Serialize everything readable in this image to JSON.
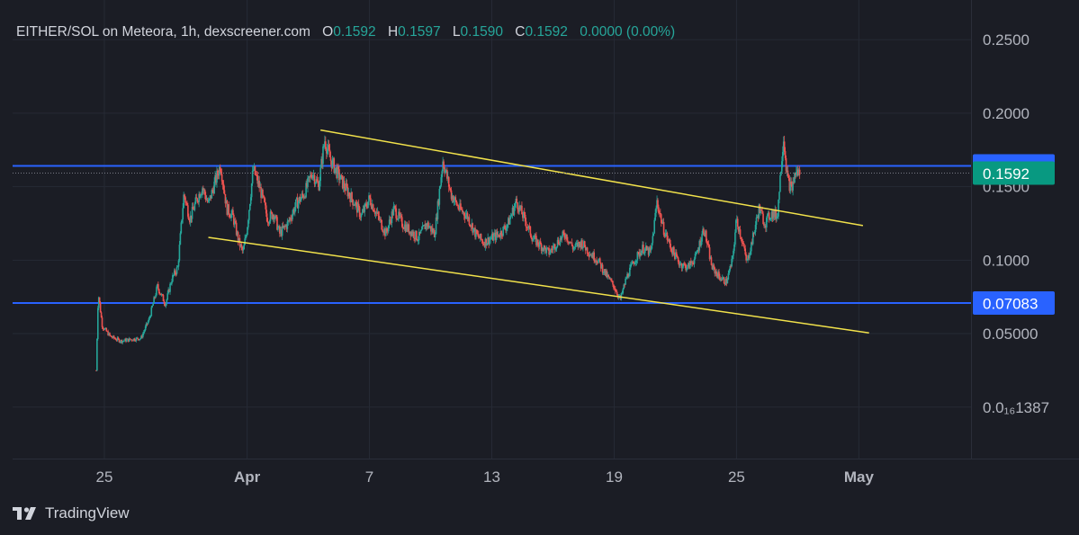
{
  "header": {
    "pair": "EITHER/SOL",
    "exchange": "on Meteora",
    "interval": "1h",
    "source": "dexscreener.com",
    "ohlc": [
      {
        "key": "O",
        "value": "0.1592"
      },
      {
        "key": "H",
        "value": "0.1597"
      },
      {
        "key": "L",
        "value": "0.1590"
      },
      {
        "key": "C",
        "value": "0.1592"
      }
    ],
    "change": "0.0000 (0.00%)"
  },
  "brand": {
    "logo_icon": "tradingview-logo-icon",
    "name": "TradingView"
  },
  "colors": {
    "background": "#1b1d25",
    "up": "#26a69a",
    "down": "#ef5350",
    "horizontal_line": "#2962ff",
    "trendline": "#f2e24b",
    "last_price_label": "#089981",
    "hline_label": "#2962ff"
  },
  "chart_data": {
    "type": "candlestick",
    "y_ticks": [
      "0.2500",
      "0.2000",
      "0.1500",
      "0.1000",
      "0.05000",
      "0.0₁₆1387"
    ],
    "y_tick_values": [
      0.25,
      0.2,
      0.15,
      0.1,
      0.05,
      0.0
    ],
    "x_ticks": [
      "25",
      "Apr",
      "7",
      "13",
      "19",
      "25",
      "May"
    ],
    "x_tick_days": [
      25,
      32,
      38,
      44,
      50,
      56,
      62
    ],
    "x_unit": "day index (March 1 = 1)",
    "xlim": [
      20.5,
      67.5
    ],
    "ylim": [
      -0.035,
      0.277
    ],
    "grid": true,
    "horizontal_lines": [
      {
        "value": 0.1641,
        "label": "0.1641"
      },
      {
        "value": 0.07083,
        "label": "0.07083"
      }
    ],
    "last_price": {
      "value": 0.1592,
      "label": "0.1592"
    },
    "trendlines": [
      {
        "from": {
          "day": 35.6,
          "price": 0.1885
        },
        "to": {
          "day": 62.2,
          "price": 0.1235
        }
      },
      {
        "from": {
          "day": 30.1,
          "price": 0.1155
        },
        "to": {
          "day": 62.5,
          "price": 0.0505
        }
      }
    ],
    "price_path": [
      [
        24.6,
        0.025
      ],
      [
        24.7,
        0.078
      ],
      [
        24.9,
        0.055
      ],
      [
        25.3,
        0.048
      ],
      [
        25.8,
        0.045
      ],
      [
        26.3,
        0.046
      ],
      [
        26.8,
        0.047
      ],
      [
        27.2,
        0.06
      ],
      [
        27.6,
        0.082
      ],
      [
        28.0,
        0.07
      ],
      [
        28.3,
        0.087
      ],
      [
        28.6,
        0.095
      ],
      [
        28.9,
        0.145
      ],
      [
        29.2,
        0.128
      ],
      [
        29.5,
        0.14
      ],
      [
        29.8,
        0.15
      ],
      [
        30.1,
        0.138
      ],
      [
        30.4,
        0.152
      ],
      [
        30.7,
        0.165
      ],
      [
        31.0,
        0.135
      ],
      [
        31.3,
        0.13
      ],
      [
        31.6,
        0.112
      ],
      [
        31.8,
        0.105
      ],
      [
        32.0,
        0.122
      ],
      [
        32.3,
        0.162
      ],
      [
        32.6,
        0.15
      ],
      [
        32.8,
        0.14
      ],
      [
        33.0,
        0.128
      ],
      [
        33.3,
        0.132
      ],
      [
        33.6,
        0.118
      ],
      [
        34.0,
        0.125
      ],
      [
        34.4,
        0.138
      ],
      [
        34.8,
        0.145
      ],
      [
        35.2,
        0.16
      ],
      [
        35.5,
        0.15
      ],
      [
        35.8,
        0.182
      ],
      [
        36.1,
        0.168
      ],
      [
        36.4,
        0.16
      ],
      [
        36.7,
        0.152
      ],
      [
        37.0,
        0.145
      ],
      [
        37.3,
        0.138
      ],
      [
        37.6,
        0.13
      ],
      [
        38.0,
        0.142
      ],
      [
        38.4,
        0.13
      ],
      [
        38.8,
        0.118
      ],
      [
        39.2,
        0.135
      ],
      [
        39.6,
        0.125
      ],
      [
        40.0,
        0.12
      ],
      [
        40.4,
        0.115
      ],
      [
        40.8,
        0.125
      ],
      [
        41.2,
        0.118
      ],
      [
        41.6,
        0.168
      ],
      [
        42.0,
        0.145
      ],
      [
        42.4,
        0.135
      ],
      [
        42.8,
        0.13
      ],
      [
        43.2,
        0.118
      ],
      [
        43.6,
        0.112
      ],
      [
        44.0,
        0.115
      ],
      [
        44.4,
        0.118
      ],
      [
        44.8,
        0.125
      ],
      [
        45.2,
        0.14
      ],
      [
        45.6,
        0.128
      ],
      [
        46.0,
        0.115
      ],
      [
        46.4,
        0.11
      ],
      [
        46.8,
        0.105
      ],
      [
        47.2,
        0.112
      ],
      [
        47.6,
        0.118
      ],
      [
        48.0,
        0.108
      ],
      [
        48.4,
        0.112
      ],
      [
        48.8,
        0.105
      ],
      [
        49.2,
        0.1
      ],
      [
        49.6,
        0.09
      ],
      [
        50.0,
        0.082
      ],
      [
        50.3,
        0.073
      ],
      [
        50.6,
        0.088
      ],
      [
        51.0,
        0.1
      ],
      [
        51.4,
        0.108
      ],
      [
        51.8,
        0.105
      ],
      [
        52.1,
        0.14
      ],
      [
        52.4,
        0.122
      ],
      [
        52.8,
        0.108
      ],
      [
        53.2,
        0.098
      ],
      [
        53.6,
        0.095
      ],
      [
        54.0,
        0.102
      ],
      [
        54.4,
        0.122
      ],
      [
        54.8,
        0.095
      ],
      [
        55.2,
        0.088
      ],
      [
        55.5,
        0.085
      ],
      [
        55.8,
        0.1
      ],
      [
        56.0,
        0.128
      ],
      [
        56.3,
        0.112
      ],
      [
        56.5,
        0.098
      ],
      [
        56.8,
        0.115
      ],
      [
        57.1,
        0.135
      ],
      [
        57.4,
        0.125
      ],
      [
        57.7,
        0.132
      ],
      [
        58.0,
        0.13
      ],
      [
        58.3,
        0.185
      ],
      [
        58.5,
        0.155
      ],
      [
        58.7,
        0.148
      ],
      [
        58.9,
        0.16
      ],
      [
        59.1,
        0.1592
      ]
    ]
  }
}
